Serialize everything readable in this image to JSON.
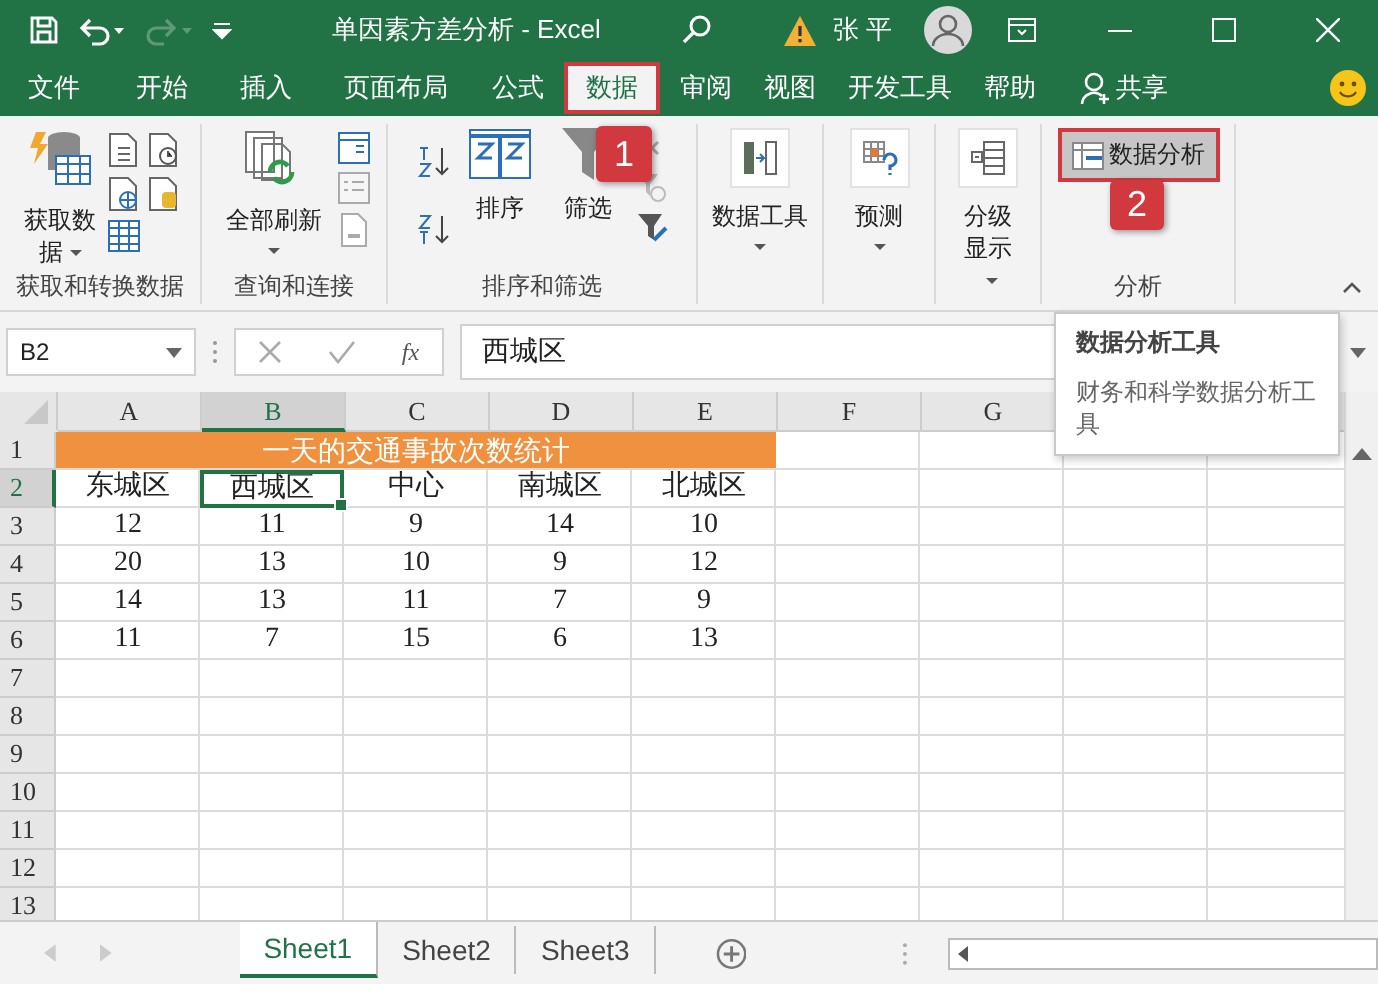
{
  "window": {
    "title": "单因素方差分析  -  Excel",
    "user": "张 平"
  },
  "tabs": [
    {
      "label": "文件",
      "selected": false,
      "highlighted": false
    },
    {
      "label": "开始",
      "selected": false,
      "highlighted": false
    },
    {
      "label": "插入",
      "selected": false,
      "highlighted": false
    },
    {
      "label": "页面布局",
      "selected": false,
      "highlighted": false
    },
    {
      "label": "公式",
      "selected": false,
      "highlighted": false
    },
    {
      "label": "数据",
      "selected": true,
      "highlighted": true
    },
    {
      "label": "审阅",
      "selected": false,
      "highlighted": false
    },
    {
      "label": "视图",
      "selected": false,
      "highlighted": false
    },
    {
      "label": "开发工具",
      "selected": false,
      "highlighted": false
    },
    {
      "label": "帮助",
      "selected": false,
      "highlighted": false
    }
  ],
  "share": "共享",
  "ribbon": {
    "groups": [
      {
        "label": "获取和转换数据",
        "buttons": [
          "获取数据"
        ]
      },
      {
        "label": "查询和连接",
        "buttons": [
          "全部刷新"
        ]
      },
      {
        "label": "排序和筛选",
        "buttons": [
          "排序",
          "筛选"
        ]
      },
      {
        "buttons": [
          "数据工具"
        ]
      },
      {
        "buttons": [
          "预测"
        ]
      },
      {
        "buttons": [
          "分级显示"
        ]
      },
      {
        "label": "分析",
        "buttons": [
          "数据分析"
        ],
        "highlighted": true
      }
    ]
  },
  "callouts": [
    "1",
    "2"
  ],
  "formula_bar": {
    "name_box": "B2",
    "fx": "fx",
    "value": "西城区"
  },
  "tooltip": {
    "title": "数据分析工具",
    "description": "财务和科学数据分析工具"
  },
  "grid": {
    "columns": [
      {
        "label": "A",
        "selected": false
      },
      {
        "label": "B",
        "selected": true
      },
      {
        "label": "C",
        "selected": false
      },
      {
        "label": "D",
        "selected": false
      },
      {
        "label": "E",
        "selected": false
      },
      {
        "label": "F",
        "selected": false
      },
      {
        "label": "G",
        "selected": false
      }
    ],
    "rows": [
      {
        "number": "1",
        "selected": false,
        "title": "一天的交通事故次数统计"
      },
      {
        "number": "2",
        "selected": true,
        "cells": [
          {
            "text": "东城区",
            "selected": false
          },
          {
            "text": "西城区",
            "selected": true
          },
          {
            "text": "中心",
            "selected": false
          },
          {
            "text": "南城区",
            "selected": false
          },
          {
            "text": "北城区",
            "selected": false
          }
        ]
      },
      {
        "number": "3",
        "selected": false,
        "cells": [
          {
            "text": "12",
            "selected": false
          },
          {
            "text": "11",
            "selected": false
          },
          {
            "text": "9",
            "selected": false
          },
          {
            "text": "14",
            "selected": false
          },
          {
            "text": "10",
            "selected": false
          }
        ]
      },
      {
        "number": "4",
        "selected": false,
        "cells": [
          {
            "text": "20",
            "selected": false
          },
          {
            "text": "13",
            "selected": false
          },
          {
            "text": "10",
            "selected": false
          },
          {
            "text": "9",
            "selected": false
          },
          {
            "text": "12",
            "selected": false
          }
        ]
      },
      {
        "number": "5",
        "selected": false,
        "cells": [
          {
            "text": "14",
            "selected": false
          },
          {
            "text": "13",
            "selected": false
          },
          {
            "text": "11",
            "selected": false
          },
          {
            "text": "7",
            "selected": false
          },
          {
            "text": "9",
            "selected": false
          }
        ]
      },
      {
        "number": "6",
        "selected": false,
        "cells": [
          {
            "text": "11",
            "selected": false
          },
          {
            "text": "7",
            "selected": false
          },
          {
            "text": "15",
            "selected": false
          },
          {
            "text": "6",
            "selected": false
          },
          {
            "text": "13",
            "selected": false
          }
        ]
      },
      {
        "number": "7",
        "selected": false
      },
      {
        "number": "8",
        "selected": false
      },
      {
        "number": "9",
        "selected": false
      },
      {
        "number": "10",
        "selected": false
      },
      {
        "number": "11",
        "selected": false
      },
      {
        "number": "12",
        "selected": false
      },
      {
        "number": "13",
        "selected": false
      }
    ]
  },
  "sheets": [
    {
      "label": "Sheet1",
      "selected": true
    },
    {
      "label": "Sheet2",
      "selected": false
    },
    {
      "label": "Sheet3",
      "selected": false
    }
  ]
}
